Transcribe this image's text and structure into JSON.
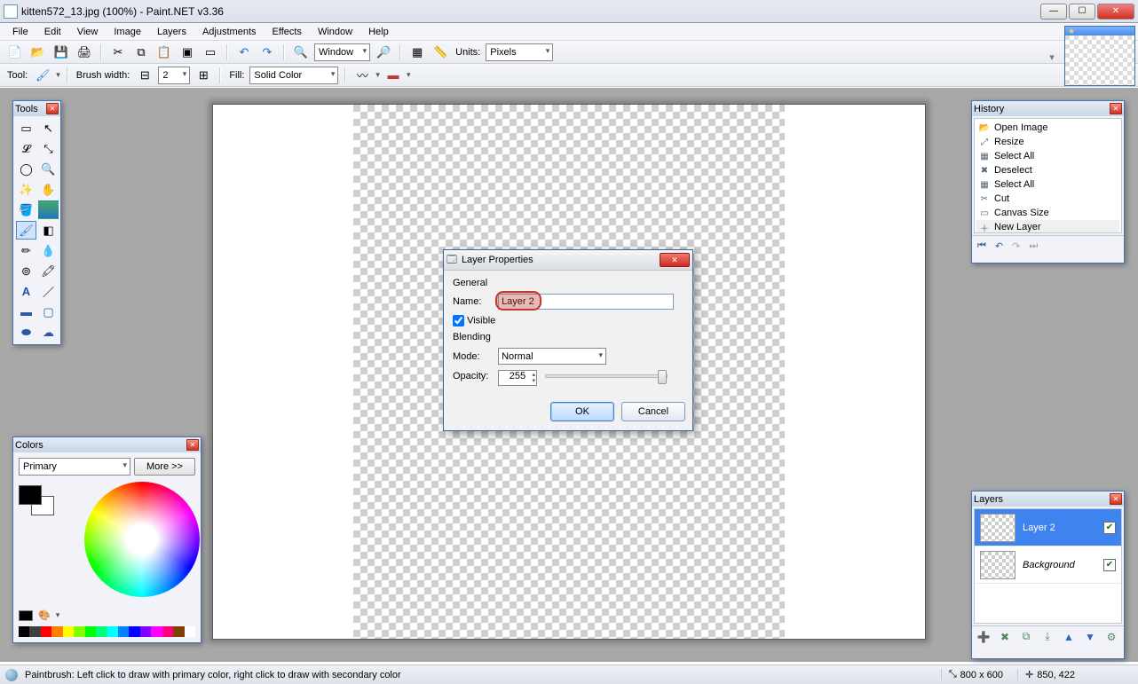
{
  "window": {
    "title": "kitten572_13.jpg (100%) - Paint.NET v3.36"
  },
  "menu": [
    "File",
    "Edit",
    "View",
    "Image",
    "Layers",
    "Adjustments",
    "Effects",
    "Window",
    "Help"
  ],
  "toolbar": {
    "window_label": "Window",
    "units_label": "Units:",
    "units_value": "Pixels"
  },
  "optionbar": {
    "tool_label": "Tool:",
    "brush_label": "Brush width:",
    "brush_value": "2",
    "fill_label": "Fill:",
    "fill_value": "Solid Color"
  },
  "panels": {
    "tools": {
      "title": "Tools"
    },
    "colors": {
      "title": "Colors",
      "target": "Primary",
      "more": "More >>"
    },
    "history": {
      "title": "History",
      "items": [
        {
          "icon": "📂",
          "label": "Open Image"
        },
        {
          "icon": "⤢",
          "label": "Resize"
        },
        {
          "icon": "▦",
          "label": "Select All"
        },
        {
          "icon": "✖",
          "label": "Deselect"
        },
        {
          "icon": "▦",
          "label": "Select All"
        },
        {
          "icon": "✂",
          "label": "Cut"
        },
        {
          "icon": "▭",
          "label": "Canvas Size"
        },
        {
          "icon": "＋",
          "label": "New Layer"
        }
      ]
    },
    "layers": {
      "title": "Layers",
      "items": [
        {
          "name": "Layer 2",
          "selected": true,
          "visible": true,
          "italic": false
        },
        {
          "name": "Background",
          "selected": false,
          "visible": true,
          "italic": true
        }
      ]
    }
  },
  "dialog": {
    "title": "Layer Properties",
    "general": "General",
    "name_label": "Name:",
    "name_value": "Layer 2",
    "visible_label": "Visible",
    "visible_checked": true,
    "blending": "Blending",
    "mode_label": "Mode:",
    "mode_value": "Normal",
    "opacity_label": "Opacity:",
    "opacity_value": "255",
    "ok": "OK",
    "cancel": "Cancel"
  },
  "status": {
    "hint": "Paintbrush: Left click to draw with primary color, right click to draw with secondary color",
    "size": "800 x 600",
    "cursor": "850, 422"
  },
  "palette": [
    "#000000",
    "#404040",
    "#ff0000",
    "#ff8000",
    "#ffff00",
    "#80ff00",
    "#00ff00",
    "#00ff80",
    "#00ffff",
    "#0080ff",
    "#0000ff",
    "#8000ff",
    "#ff00ff",
    "#ff0080",
    "#804000",
    "#ffffff"
  ]
}
